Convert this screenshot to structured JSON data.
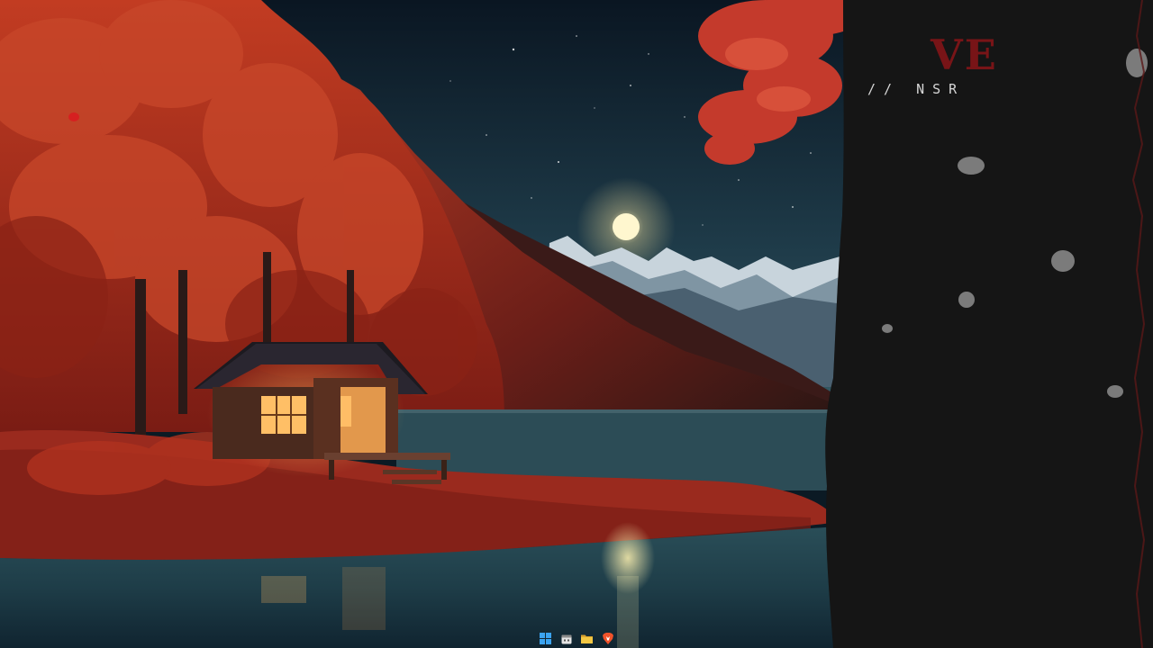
{
  "desktop": {
    "wallpaper_name": "autumn-lake-cabin-night",
    "colors": {
      "sky_top": "#0e1f2e",
      "sky_bottom": "#2a4a58",
      "foliage": "#b4301f",
      "foliage_dark": "#6e1a14",
      "lake": "#2c5862",
      "cabin_light": "#ffb860",
      "rock_panel": "#111111",
      "accent_red": "#8a1418"
    }
  },
  "widget": {
    "title": "VE",
    "subtitle": "// NSR"
  },
  "taskbar": {
    "icons": [
      {
        "name": "windows-start-icon",
        "color": "#3ba3f0"
      },
      {
        "name": "calendar-icon",
        "color": "#e5e5e5"
      },
      {
        "name": "file-explorer-icon",
        "color": "#f2c744"
      },
      {
        "name": "brave-browser-icon",
        "color": "#f0522a"
      }
    ]
  }
}
